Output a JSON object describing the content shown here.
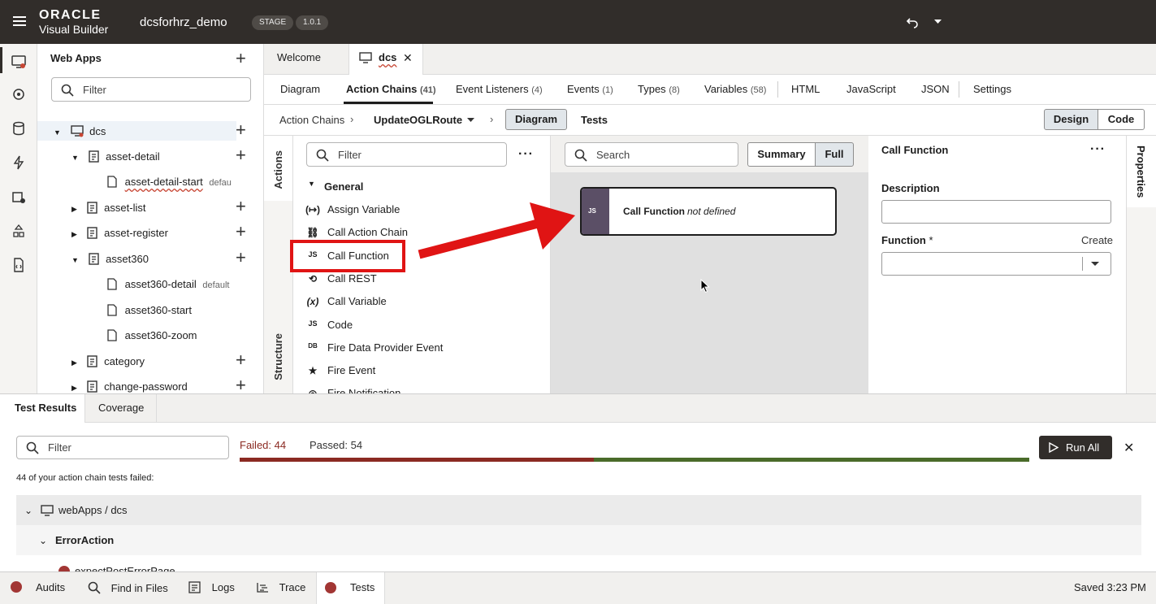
{
  "topbar": {
    "brand": "ORACLE",
    "product": "Visual Builder",
    "app_name": "dcsforhrz_demo",
    "stage_badge": "STAGE",
    "version_badge": "1.0.1"
  },
  "webapps": {
    "title": "Web Apps",
    "filter_placeholder": "Filter",
    "tree": [
      {
        "label": "dcs"
      },
      {
        "label": "asset-detail"
      },
      {
        "label": "asset-detail-start",
        "tag": "defau"
      },
      {
        "label": "asset-list"
      },
      {
        "label": "asset-register"
      },
      {
        "label": "asset360"
      },
      {
        "label": "asset360-detail",
        "tag": "default"
      },
      {
        "label": "asset360-start"
      },
      {
        "label": "asset360-zoom"
      },
      {
        "label": "category"
      },
      {
        "label": "change-password"
      }
    ]
  },
  "doc_tabs": {
    "welcome": "Welcome",
    "dcs": "dcs"
  },
  "sub_tabs": [
    {
      "label": "Diagram",
      "count": ""
    },
    {
      "label": "Action Chains",
      "count": "(41)"
    },
    {
      "label": "Event Listeners",
      "count": "(4)"
    },
    {
      "label": "Events",
      "count": "(1)"
    },
    {
      "label": "Types",
      "count": "(8)"
    },
    {
      "label": "Variables",
      "count": "(58)"
    },
    {
      "label": "HTML",
      "count": ""
    },
    {
      "label": "JavaScript",
      "count": ""
    },
    {
      "label": "JSON",
      "count": ""
    },
    {
      "label": "Settings",
      "count": ""
    }
  ],
  "breadcrumb": {
    "root": "Action Chains",
    "chain": "UpdateOGLRoute",
    "diagram": "Diagram",
    "tests": "Tests",
    "design": "Design",
    "code": "Code"
  },
  "vtabs": {
    "actions": "Actions",
    "structure": "Structure",
    "properties": "Properties"
  },
  "palette": {
    "filter_placeholder": "Filter",
    "group": "General",
    "items": [
      "Assign Variable",
      "Call Action Chain",
      "Call Function",
      "Call REST",
      "Call Variable",
      "Code",
      "Fire Data Provider Event",
      "Fire Event",
      "Fire Notification"
    ],
    "icons": [
      "(↦)",
      "⛓",
      "JS",
      "⟲",
      "(x)",
      "JS",
      "DB",
      "★",
      "◎"
    ]
  },
  "canvas": {
    "search_placeholder": "Search",
    "summary": "Summary",
    "full": "Full",
    "node_title": "Call Function",
    "node_status": "not defined",
    "node_icon": "JS"
  },
  "properties": {
    "title": "Call Function",
    "description_label": "Description",
    "function_label": "Function",
    "required_mark": "*",
    "create_link": "Create"
  },
  "test_results": {
    "tab_results": "Test Results",
    "tab_coverage": "Coverage",
    "filter_placeholder": "Filter",
    "failed": "Failed: 44",
    "passed": "Passed: 54",
    "failed_count": 44,
    "passed_count": 54,
    "run_all": "Run All",
    "summary": "44 of your action chain tests failed:",
    "group_path": "webApps / dcs",
    "group_error": "ErrorAction",
    "child_item": "expectPostErrorPage"
  },
  "statusbar": {
    "audits": "Audits",
    "find": "Find in Files",
    "logs": "Logs",
    "trace": "Trace",
    "tests": "Tests",
    "saved": "Saved 3:23 PM"
  },
  "colors": {
    "topbar": "#312d2a",
    "failed": "#8b2a22",
    "passed": "#4a6b2a",
    "annotation": "#e01414",
    "node_accent": "#5b4f66"
  }
}
